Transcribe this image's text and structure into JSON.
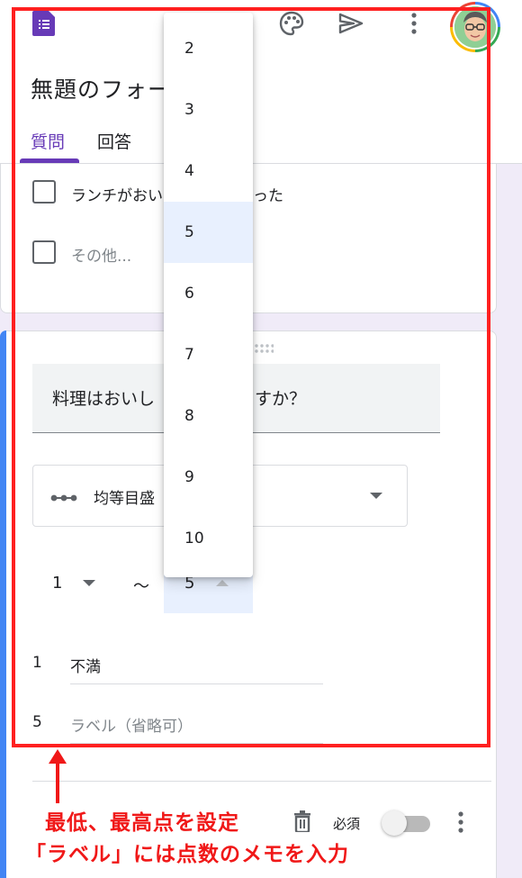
{
  "form": {
    "title": "無題のフォー",
    "tabs": [
      "質問",
      "回答"
    ]
  },
  "previous_question": {
    "options": [
      "ランチがおい",
      "った",
      "その他..."
    ]
  },
  "question": {
    "title_left": "料理はおいし",
    "title_right": "すか？",
    "type_label": "均等目盛",
    "scale_min": "1",
    "scale_sep": "〜",
    "scale_max": "5",
    "min_label_num": "1",
    "min_label_value": "不満",
    "max_label_num": "5",
    "max_label_placeholder": "ラベル（省略可）",
    "required_label": "必須"
  },
  "dropdown": {
    "options": [
      "2",
      "3",
      "4",
      "5",
      "6",
      "7",
      "8",
      "9",
      "10"
    ],
    "selected": "5"
  },
  "annotation": {
    "line1": "最低、最高点を設定",
    "line2": "「ラベル」には点数のメモを入力"
  },
  "colors": {
    "accent": "#673ab7",
    "annotation_red": "#ff2020",
    "card_accent": "#4285f4",
    "page_bg": "#f0ebf8"
  }
}
